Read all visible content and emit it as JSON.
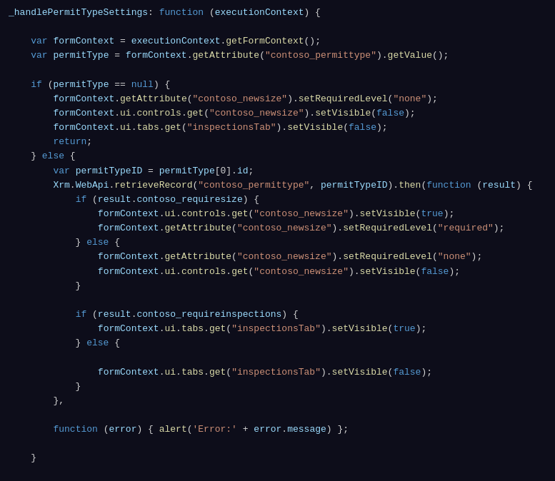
{
  "code": {
    "lines": [
      {
        "id": 1,
        "content": "_handlePermitTypeSettings: function (executionContext) {"
      },
      {
        "id": 2,
        "content": ""
      },
      {
        "id": 3,
        "content": "    var formContext = executionContext.getFormContext();"
      },
      {
        "id": 4,
        "content": "    var permitType = formContext.getAttribute(\"contoso_permittype\").getValue();"
      },
      {
        "id": 5,
        "content": ""
      },
      {
        "id": 6,
        "content": "    if (permitType == null) {"
      },
      {
        "id": 7,
        "content": "        formContext.getAttribute(\"contoso_newsize\").setRequiredLevel(\"none\");"
      },
      {
        "id": 8,
        "content": "        formContext.ui.controls.get(\"contoso_newsize\").setVisible(false);"
      },
      {
        "id": 9,
        "content": "        formContext.ui.tabs.get(\"inspectionsTab\").setVisible(false);"
      },
      {
        "id": 10,
        "content": "        return;"
      },
      {
        "id": 11,
        "content": "    } else {"
      },
      {
        "id": 12,
        "content": "        var permitTypeID = permitType[0].id;"
      },
      {
        "id": 13,
        "content": "        Xrm.WebApi.retrieveRecord(\"contoso_permittype\", permitTypeID).then(function (result) {"
      },
      {
        "id": 14,
        "content": "            if (result.contoso_requiresize) {"
      },
      {
        "id": 15,
        "content": "                formContext.ui.controls.get(\"contoso_newsize\").setVisible(true);"
      },
      {
        "id": 16,
        "content": "                formContext.getAttribute(\"contoso_newsize\").setRequiredLevel(\"required\");"
      },
      {
        "id": 17,
        "content": "            } else {"
      },
      {
        "id": 18,
        "content": "                formContext.getAttribute(\"contoso_newsize\").setRequiredLevel(\"none\");"
      },
      {
        "id": 19,
        "content": "                formContext.ui.controls.get(\"contoso_newsize\").setVisible(false);"
      },
      {
        "id": 20,
        "content": "            }"
      },
      {
        "id": 21,
        "content": ""
      },
      {
        "id": 22,
        "content": "            if (result.contoso_requireinspections) {"
      },
      {
        "id": 23,
        "content": "                formContext.ui.tabs.get(\"inspectionsTab\").setVisible(true);"
      },
      {
        "id": 24,
        "content": "            } else {"
      },
      {
        "id": 25,
        "content": ""
      },
      {
        "id": 26,
        "content": "                formContext.ui.tabs.get(\"inspectionsTab\").setVisible(false);"
      },
      {
        "id": 27,
        "content": "            }"
      },
      {
        "id": 28,
        "content": "        },"
      },
      {
        "id": 29,
        "content": ""
      },
      {
        "id": 30,
        "content": "        function (error) { alert('Error:' + error.message) };"
      },
      {
        "id": 31,
        "content": ""
      },
      {
        "id": 32,
        "content": "    }"
      },
      {
        "id": 33,
        "content": ""
      },
      {
        "id": 34,
        "content": "},"
      }
    ]
  },
  "colors": {
    "bg": "#0d0d1a",
    "keyword": "#569cd6",
    "string": "#ce9178",
    "function_name": "#dcdcaa",
    "plain": "#d4d4d4",
    "variable": "#9cdcfe"
  }
}
